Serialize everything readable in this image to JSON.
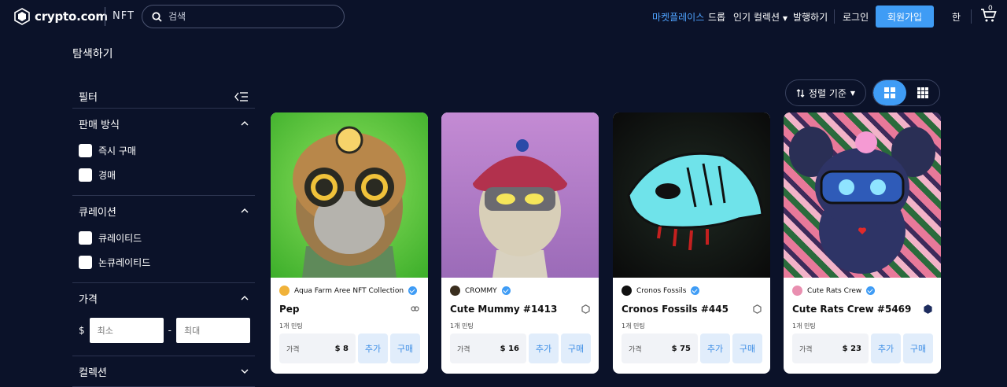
{
  "header": {
    "logo_text": "crypto.com",
    "logo_sub": "NFT",
    "search_placeholder": "검색",
    "nav": {
      "marketplace": "마켓플레이스",
      "drops": "드롭",
      "popular": "인기 컬렉션",
      "issue": "발행하기",
      "login": "로그인",
      "signup": "회원가입",
      "lang": "한",
      "cart_count": "0"
    }
  },
  "page": {
    "title": "탐색하기"
  },
  "filters": {
    "title": "필터",
    "sale_method": {
      "title": "판매 방식",
      "options": [
        "즉시 구매",
        "경매"
      ]
    },
    "curation": {
      "title": "큐레이션",
      "options": [
        "큐레이티드",
        "논큐레이티드"
      ]
    },
    "price": {
      "title": "가격",
      "currency": "$",
      "min_placeholder": "최소",
      "dash": "-",
      "max_placeholder": "최대"
    },
    "collection": {
      "title": "컬렉션"
    }
  },
  "toolbar": {
    "sort_label": "정렬 기준"
  },
  "cards": [
    {
      "collection": "Aqua Farm Aree NFT Collection",
      "name": "Pep",
      "mint": "1개 민팅",
      "price_label": "가격",
      "price": "$ 8",
      "add": "추가",
      "buy": "구매"
    },
    {
      "collection": "CROMMY",
      "name": "Cute Mummy #1413",
      "mint": "1개 민팅",
      "price_label": "가격",
      "price": "$ 16",
      "add": "추가",
      "buy": "구매"
    },
    {
      "collection": "Cronos Fossils",
      "name": "Cronos Fossils #445",
      "mint": "1개 민팅",
      "price_label": "가격",
      "price": "$ 75",
      "add": "추가",
      "buy": "구매"
    },
    {
      "collection": "Cute Rats Crew",
      "name": "Cute Rats Crew #5469",
      "mint": "1개 민팅",
      "price_label": "가격",
      "price": "$ 23",
      "add": "추가",
      "buy": "구매"
    }
  ],
  "colors": {
    "bg": "#0b1229",
    "accent": "#3f9cf5",
    "active_nav": "#4fa3ff"
  }
}
